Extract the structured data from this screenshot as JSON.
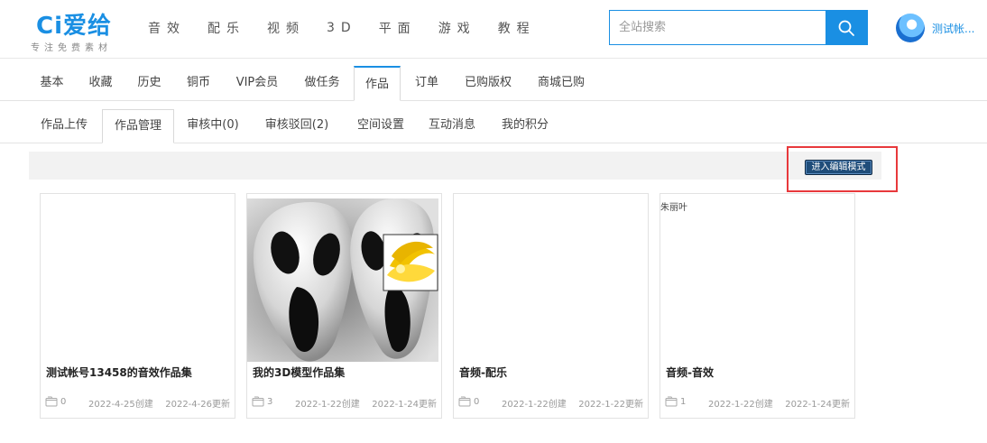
{
  "logo": {
    "brand": "Ci爱给",
    "slogan": "专注免费素材"
  },
  "topnav": [
    "音效",
    "配乐",
    "视频",
    "3D",
    "平面",
    "游戏",
    "教程"
  ],
  "search": {
    "placeholder": "全站搜索",
    "icon": "search-icon"
  },
  "user": {
    "name": "测试帐..."
  },
  "tabs_primary": {
    "items": [
      "基本",
      "收藏",
      "历史",
      "铜币",
      "VIP会员",
      "做任务",
      "作品",
      "订单",
      "已购版权",
      "商城已购"
    ],
    "active": "作品"
  },
  "tabs_secondary": {
    "items": [
      "作品上传",
      "作品管理",
      "审核中(0)",
      "审核驳回(2)",
      "空间设置",
      "互动消息",
      "我的积分"
    ],
    "active": "作品管理"
  },
  "edit_mode_button": "进入编辑模式",
  "highlight_color": "#e8393c",
  "accent_color": "#1a8fe3",
  "cards": [
    {
      "tag": "",
      "title": "测试帐号13458的音效作品集",
      "count": "0",
      "created": "2022-4-25创建",
      "updated": "2022-4-26更新"
    },
    {
      "tag": "",
      "title": "我的3D模型作品集",
      "count": "3",
      "created": "2022-1-22创建",
      "updated": "2022-1-24更新"
    },
    {
      "tag": "",
      "title": "音频-配乐",
      "count": "0",
      "created": "2022-1-22创建",
      "updated": "2022-1-22更新"
    },
    {
      "tag": "朱丽叶",
      "title": "音频-音效",
      "count": "1",
      "created": "2022-1-22创建",
      "updated": "2022-1-24更新"
    }
  ]
}
